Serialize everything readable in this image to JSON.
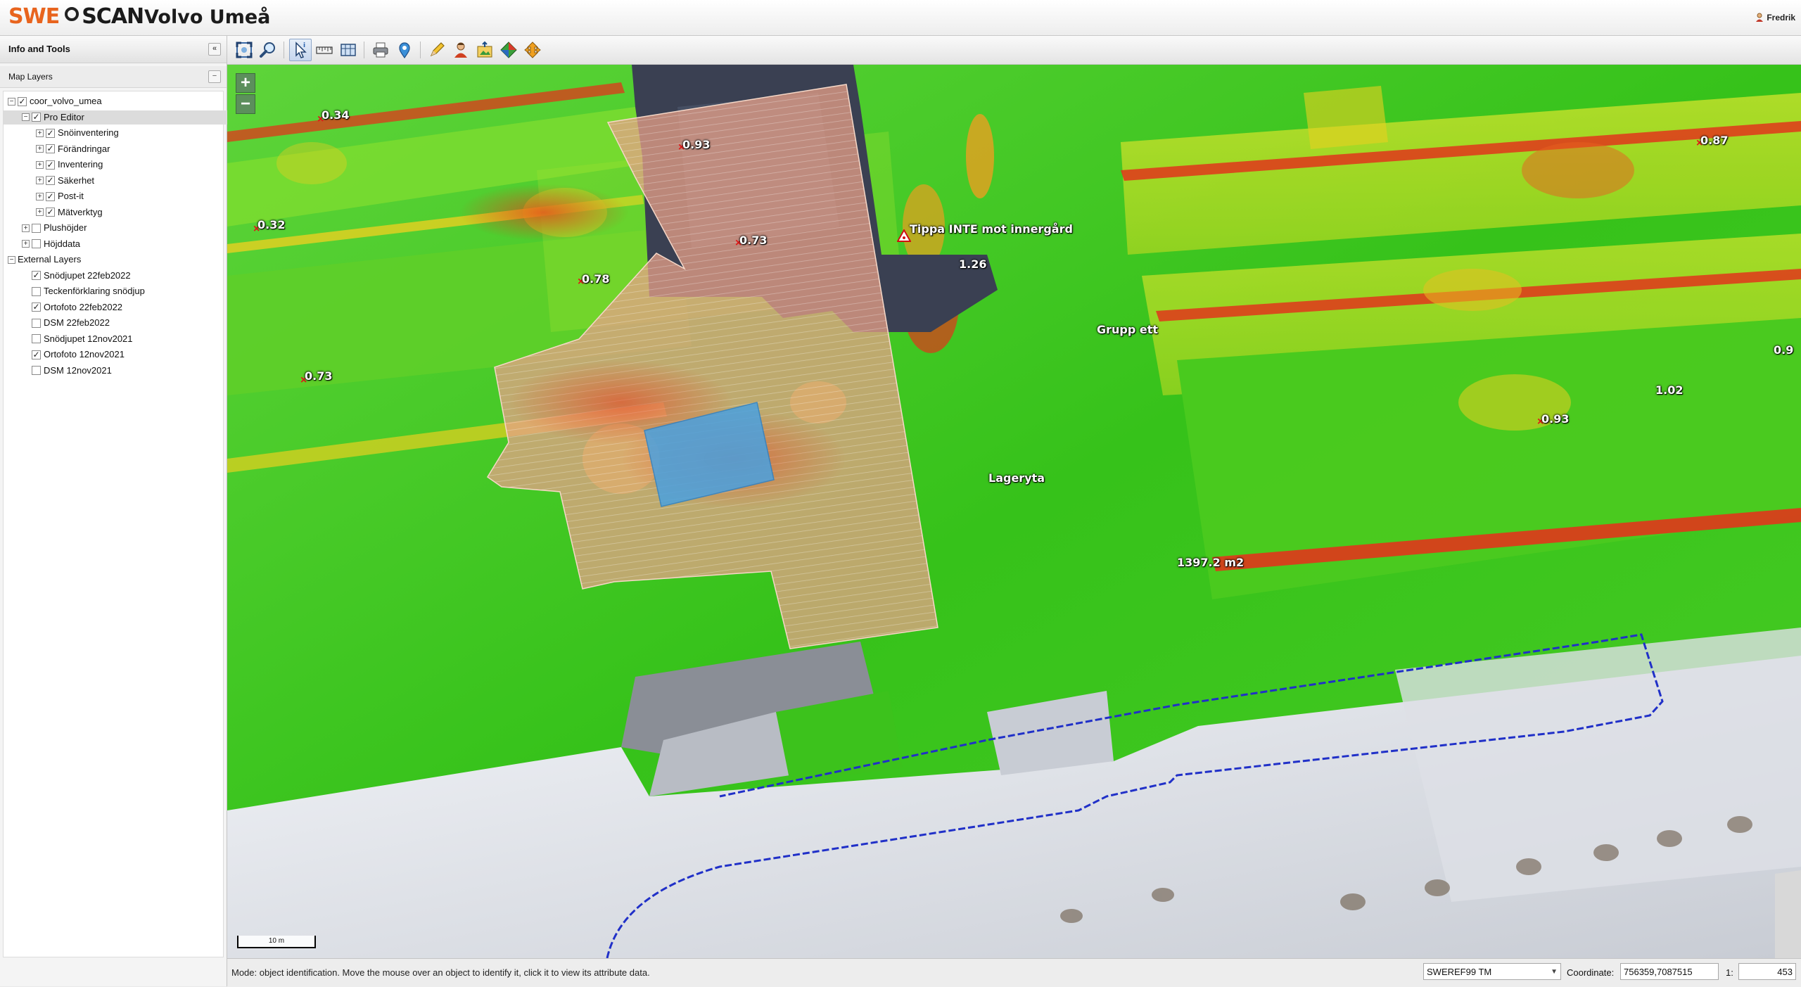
{
  "header": {
    "logo_left": "SWE",
    "logo_right": "SCAN",
    "app_title": "Volvo Umeå",
    "user": "Fredrik"
  },
  "left_panel": {
    "title": "Info and Tools",
    "collapse_glyph": "«",
    "layers_title": "Map Layers",
    "layers_glyph": "−",
    "tree": [
      {
        "label": "coor_volvo_umea",
        "level": 0,
        "expander": "−",
        "checked": true,
        "selected": false
      },
      {
        "label": "Pro Editor",
        "level": 1,
        "expander": "−",
        "checked": true,
        "selected": true
      },
      {
        "label": "Snöinventering",
        "level": 2,
        "expander": "+",
        "checked": true,
        "selected": false
      },
      {
        "label": "Förändringar",
        "level": 2,
        "expander": "+",
        "checked": true,
        "selected": false
      },
      {
        "label": "Inventering",
        "level": 2,
        "expander": "+",
        "checked": true,
        "selected": false
      },
      {
        "label": "Säkerhet",
        "level": 2,
        "expander": "+",
        "checked": true,
        "selected": false
      },
      {
        "label": "Post-it",
        "level": 2,
        "expander": "+",
        "checked": true,
        "selected": false
      },
      {
        "label": "Mätverktyg",
        "level": 2,
        "expander": "+",
        "checked": true,
        "selected": false
      },
      {
        "label": "Plushöjder",
        "level": 1,
        "expander": "+",
        "checked": false,
        "selected": false
      },
      {
        "label": "Höjddata",
        "level": 1,
        "expander": "+",
        "checked": false,
        "selected": false
      },
      {
        "label": "External Layers",
        "level": 0,
        "expander": "−",
        "checked": null,
        "selected": false
      },
      {
        "label": "Snödjupet 22feb2022",
        "level": 1,
        "expander": null,
        "checked": true,
        "selected": false
      },
      {
        "label": "Teckenförklaring snödjup",
        "level": 1,
        "expander": null,
        "checked": false,
        "selected": false
      },
      {
        "label": "Ortofoto 22feb2022",
        "level": 1,
        "expander": null,
        "checked": true,
        "selected": false
      },
      {
        "label": "DSM 22feb2022",
        "level": 1,
        "expander": null,
        "checked": false,
        "selected": false
      },
      {
        "label": "Snödjupet 12nov2021",
        "level": 1,
        "expander": null,
        "checked": false,
        "selected": false
      },
      {
        "label": "Ortofoto 12nov2021",
        "level": 1,
        "expander": null,
        "checked": true,
        "selected": false
      },
      {
        "label": "DSM 12nov2021",
        "level": 1,
        "expander": null,
        "checked": false,
        "selected": false
      }
    ]
  },
  "toolbar": {
    "tools": [
      {
        "name": "zoom-extent-icon",
        "active": false
      },
      {
        "name": "zoom-in-magnifier-icon",
        "active": false
      },
      {
        "name": "identify-cursor-icon",
        "active": true
      },
      {
        "name": "measure-ruler-icon",
        "active": false
      },
      {
        "name": "measure-area-icon",
        "active": false
      },
      {
        "name": "print-icon",
        "active": false
      },
      {
        "name": "place-marker-icon",
        "active": false
      },
      {
        "name": "pencil-draw-icon",
        "active": false
      },
      {
        "name": "user-person-icon",
        "active": false
      },
      {
        "name": "export-image-icon",
        "active": false
      },
      {
        "name": "layers-3d-icon",
        "active": false
      },
      {
        "name": "navigate-arrows-icon",
        "active": false
      }
    ]
  },
  "map": {
    "zoom_in": "+",
    "zoom_out": "−",
    "scale_label": "10 m",
    "annotations": {
      "warning_label": "Tippa INTE mot innergård",
      "group_label": "Grupp ett",
      "storage_label": "Lageryta",
      "area_label": "1397.2 m2"
    },
    "depth_values": [
      {
        "id": "d1",
        "label": "0.34"
      },
      {
        "id": "d2",
        "label": "0.32"
      },
      {
        "id": "d3",
        "label": "0.73"
      },
      {
        "id": "d4",
        "label": "0.93"
      },
      {
        "id": "d5",
        "label": "0.73"
      },
      {
        "id": "d6",
        "label": "0.78"
      },
      {
        "id": "d7",
        "label": "1.26"
      },
      {
        "id": "d8",
        "label": "0.87"
      },
      {
        "id": "d9",
        "label": "0.9"
      },
      {
        "id": "d10",
        "label": "1.02"
      },
      {
        "id": "d11",
        "label": "0.93"
      }
    ]
  },
  "status": {
    "mode_text": "Mode: object identification. Move the mouse over an object to identify it, click it to view its attribute data.",
    "crs_value": "SWEREF99 TM",
    "coordinate_label": "Coordinate:",
    "coordinate_value": "756359,7087515",
    "scale_prefix": "1:",
    "scale_value": "453"
  },
  "colors": {
    "map_green": "#3cc21c",
    "map_yellow": "#d9e020",
    "map_red": "#e0361b",
    "zone_fill": "#e8a088",
    "storage_blue": "#4aa0e0",
    "boundary_blue": "#2030c8",
    "logo_orange": "#e8641e"
  }
}
